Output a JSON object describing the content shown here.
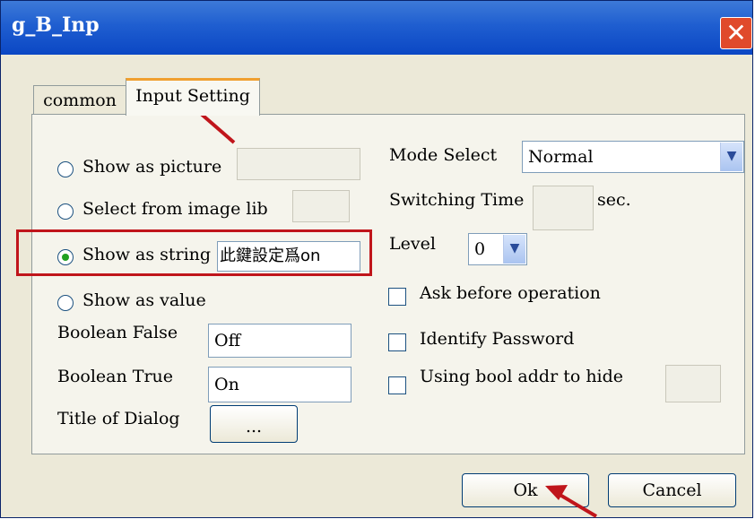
{
  "window": {
    "title": "g_B_Inp",
    "close_label": "✕"
  },
  "tabs": [
    {
      "label": "common"
    },
    {
      "label": "Input Setting"
    }
  ],
  "left": {
    "show_as_picture": "Show as picture",
    "select_from_image_lib": "Select from image lib",
    "show_as_string": "Show as string",
    "string_value": "此鍵設定爲on",
    "show_as_value": "Show as value",
    "boolean_false_label": "Boolean False",
    "boolean_false_value": "Off",
    "boolean_true_label": "Boolean True",
    "boolean_true_value": "On",
    "title_of_dialog_label": "Title of Dialog",
    "title_button": "..."
  },
  "right": {
    "mode_select_label": "Mode Select",
    "mode_value": "Normal",
    "switching_time_label": "Switching Time",
    "switching_unit": "sec.",
    "level_label": "Level",
    "level_value": "0",
    "ask_before_operation": "Ask before operation",
    "identify_password": "Identify Password",
    "using_bool_addr": "Using bool addr to hide"
  },
  "footer": {
    "ok_label": "Ok",
    "cancel_label": "Cancel"
  },
  "colors": {
    "highlight": "#c0151b",
    "titlebar": "#0b47c4",
    "close": "#e04a2b"
  }
}
